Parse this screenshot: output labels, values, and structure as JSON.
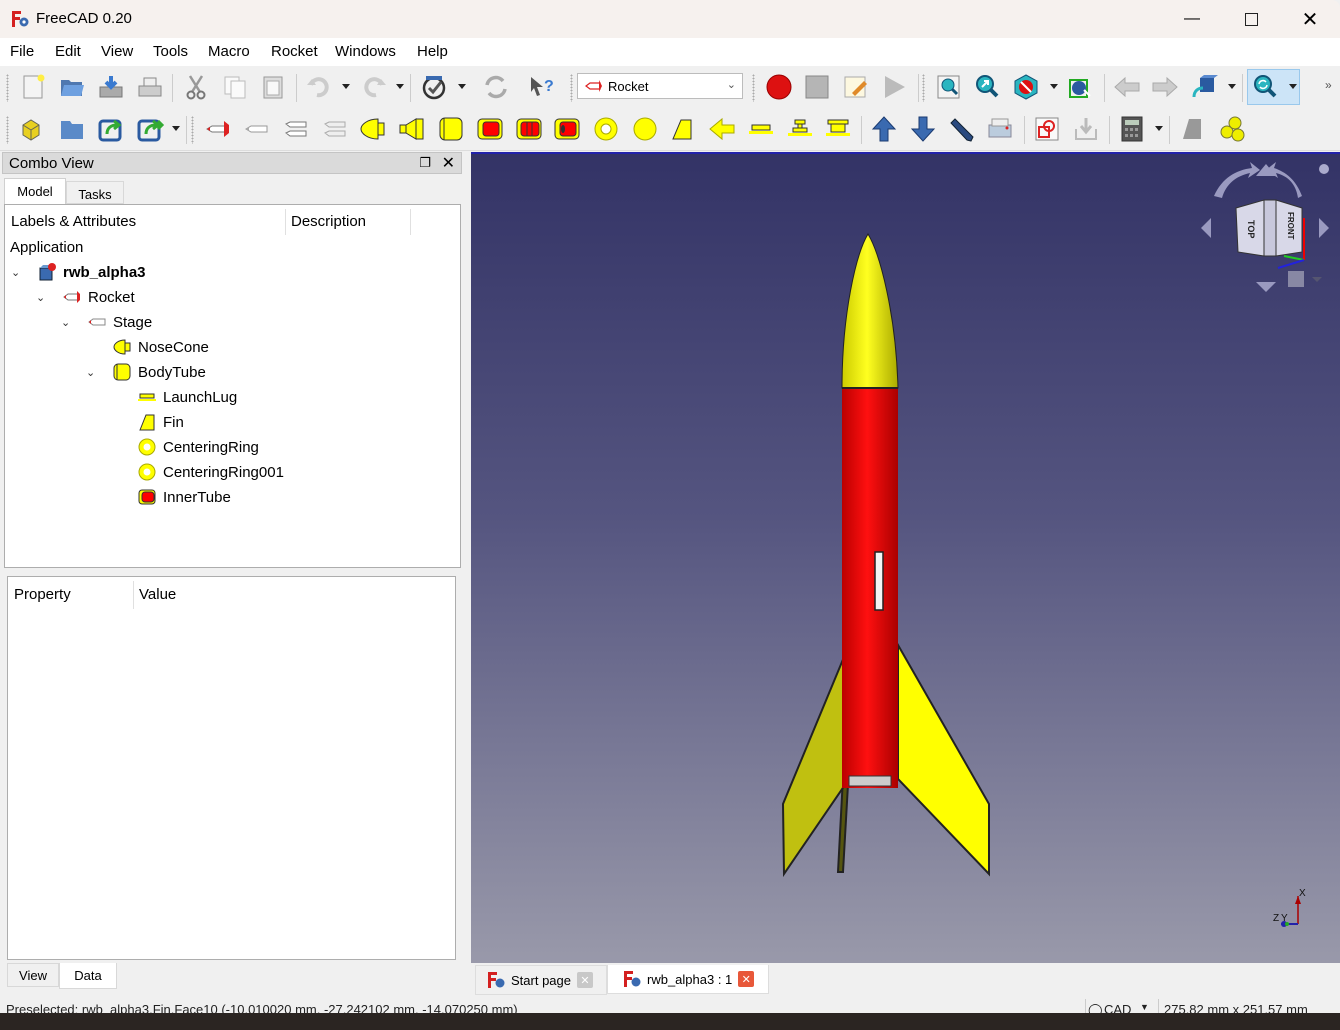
{
  "window": {
    "title": "FreeCAD 0.20",
    "controls": [
      "minimize",
      "maximize",
      "close"
    ]
  },
  "menu": [
    "File",
    "Edit",
    "View",
    "Tools",
    "Macro",
    "Rocket",
    "Windows",
    "Help"
  ],
  "toolbar1": {
    "workbench_selector": "Rocket",
    "icons": [
      "new-document-icon",
      "open-icon",
      "save-icon",
      "print-icon",
      "cut-icon",
      "copy-icon",
      "paste-icon",
      "undo-icon",
      "redo-icon",
      "refresh-icon",
      "whats-this-icon",
      "macro-record-icon",
      "macro-stop-icon",
      "macro-edit-icon",
      "macro-execute-icon",
      "fit-all-icon",
      "fit-selection-icon",
      "draw-style-icon",
      "bounding-box-icon",
      "back-icon",
      "forward-icon",
      "std-view-icon",
      "zoom-sync-icon"
    ],
    "overflow": "»"
  },
  "toolbar2": {
    "icons": [
      "part-icon",
      "group-icon",
      "link-icon",
      "link-actions-icon",
      "rocket-icon",
      "stage-icon",
      "parallel-stage-icon",
      "pod-icon",
      "nose-cone-icon",
      "transition-icon",
      "body-tube-icon",
      "coupler-icon",
      "engine-block-icon",
      "inner-tube-icon",
      "centering-ring-icon",
      "bulkhead-icon",
      "fin-icon",
      "fin-can-icon",
      "launch-lug-icon",
      "rail-button-icon",
      "rail-guide-icon",
      "move-up-icon",
      "move-down-icon",
      "edit-icon",
      "export-icon",
      "cut-view-icon",
      "import-icon",
      "calculator-icon",
      "fin-flutter-icon",
      "materials-icon"
    ]
  },
  "combo_view": {
    "title": "Combo View",
    "tabs": [
      "Model",
      "Tasks"
    ],
    "active_tab": "Model",
    "tree_columns": [
      "Labels & Attributes",
      "Description"
    ],
    "tree_root": "Application",
    "tree": [
      {
        "label": "rwb_alpha3",
        "level": 0,
        "expanded": true,
        "icon": "document-icon",
        "bold": true
      },
      {
        "label": "Rocket",
        "level": 1,
        "expanded": true,
        "icon": "rocket-icon"
      },
      {
        "label": "Stage",
        "level": 2,
        "expanded": true,
        "icon": "stage-icon"
      },
      {
        "label": "NoseCone",
        "level": 3,
        "icon": "nose-cone-icon"
      },
      {
        "label": "BodyTube",
        "level": 3,
        "expanded": true,
        "icon": "body-tube-icon"
      },
      {
        "label": "LaunchLug",
        "level": 4,
        "icon": "launch-lug-icon"
      },
      {
        "label": "Fin",
        "level": 4,
        "icon": "fin-icon"
      },
      {
        "label": "CenteringRing",
        "level": 4,
        "icon": "centering-ring-icon"
      },
      {
        "label": "CenteringRing001",
        "level": 4,
        "icon": "centering-ring-icon"
      },
      {
        "label": "InnerTube",
        "level": 4,
        "icon": "inner-tube-icon"
      }
    ],
    "property_columns": [
      "Property",
      "Value"
    ],
    "property_tabs": [
      "View",
      "Data"
    ],
    "active_property_tab": "Data"
  },
  "viewport": {
    "navcube_faces": [
      "TOP",
      "FRONT"
    ],
    "axis_labels": [
      "X",
      "Y",
      "Z"
    ],
    "colors": {
      "nose": "#ffff00",
      "body": "#ff0000",
      "fin": "#ffff00"
    }
  },
  "doc_tabs": [
    {
      "label": "Start page",
      "active": false
    },
    {
      "label": "rwb_alpha3 : 1",
      "active": true
    }
  ],
  "status": {
    "preselected": "Preselected: rwb_alpha3.Fin.Face10 (-10.010020 mm, -27.242102 mm, -14.070250 mm)",
    "nav_style": "CAD",
    "dimensions": "275.82 mm x 251.57 mm"
  }
}
